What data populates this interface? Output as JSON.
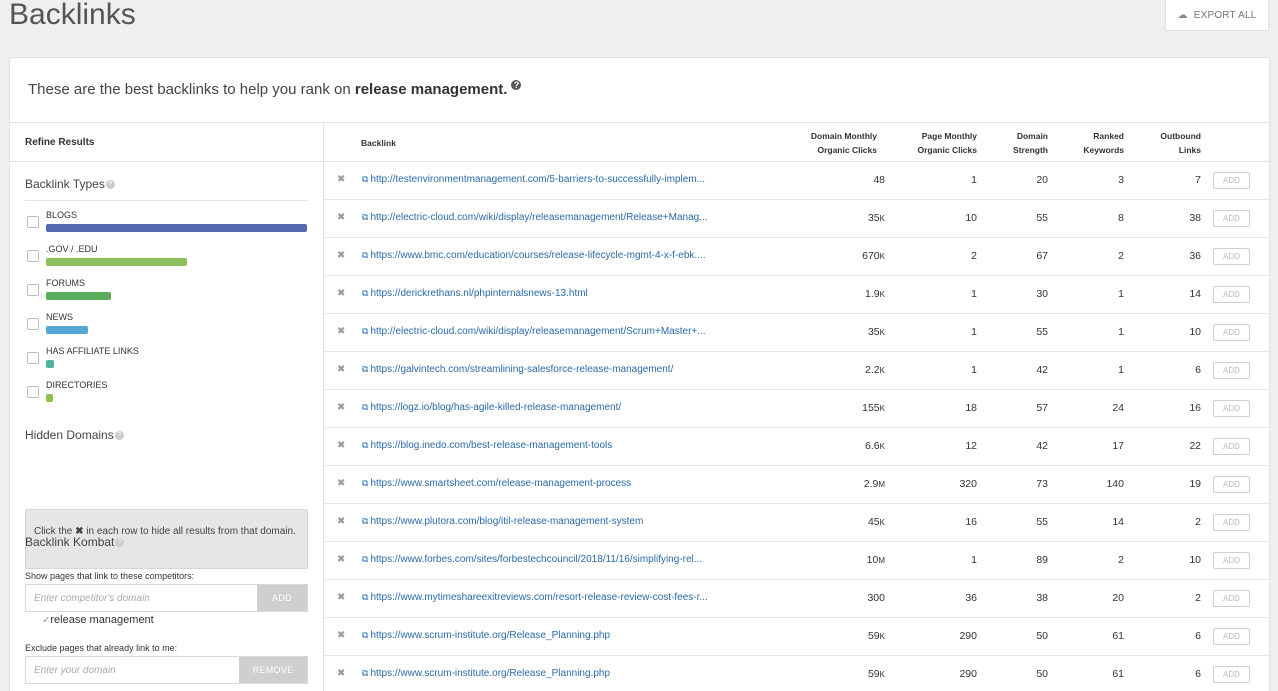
{
  "page": {
    "title": "Backlinks",
    "export_label": "EXPORT ALL"
  },
  "intro": {
    "prefix": "These are the best backlinks to help you rank on ",
    "keyword": "release management.",
    "help": "?"
  },
  "sidebar": {
    "refine_title": "Refine Results",
    "types_title": "Backlink Types",
    "types": [
      {
        "label": "BLOGS",
        "share": 1.0,
        "color": "#5468b0"
      },
      {
        "label": ".GOV / .EDU",
        "share": 0.54,
        "color": "#8dbd5c"
      },
      {
        "label": "FORUMS",
        "share": 0.25,
        "color": "#5aab5a"
      },
      {
        "label": "NEWS",
        "share": 0.16,
        "color": "#54a8d6"
      },
      {
        "label": "HAS AFFILIATE LINKS",
        "share": 0.03,
        "color": "#4fb49a"
      },
      {
        "label": "DIRECTORIES",
        "share": 0.02,
        "color": "#8fc04c"
      }
    ],
    "hidden_title": "Hidden Domains",
    "hidden_text_before": "Click the ",
    "hidden_text_icon": "✖",
    "hidden_text_after": " in each row to hide all results from that domain.",
    "kombat_title": "Backlink Kombat",
    "competitors_label": "Show pages that link to these competitors:",
    "competitor_placeholder": "Enter competitor's domain",
    "add_label": "ADD",
    "competitor_tag": "release management",
    "exclude_label": "Exclude pages that already link to me:",
    "domain_placeholder": "Enter your domain",
    "remove_label": "REMOVE"
  },
  "table": {
    "headers": {
      "backlink": "Backlink",
      "domain_clicks_1": "Domain Monthly",
      "domain_clicks_2": "Organic Clicks",
      "page_clicks_1": "Page Monthly",
      "page_clicks_2": "Organic Clicks",
      "strength_1": "Domain",
      "strength_2": "Strength",
      "ranked_1": "Ranked",
      "ranked_2": "Keywords",
      "outbound_1": "Outbound",
      "outbound_2": "Links"
    },
    "add_label": "ADD",
    "rows": [
      {
        "url": "http://testenvironmentmanagement.com/5-barriers-to-successfully-implem...",
        "domain_clicks": "48",
        "domain_unit": "",
        "page_clicks": "1",
        "strength": "20",
        "ranked": "3",
        "outbound": "7"
      },
      {
        "url": "http://electric-cloud.com/wiki/display/releasemanagement/Release+Manag...",
        "domain_clicks": "35",
        "domain_unit": "K",
        "page_clicks": "10",
        "strength": "55",
        "ranked": "8",
        "outbound": "38"
      },
      {
        "url": "https://www.bmc.com/education/courses/release-lifecycle-mgmt-4-x-f-ebk....",
        "domain_clicks": "670",
        "domain_unit": "K",
        "page_clicks": "2",
        "strength": "67",
        "ranked": "2",
        "outbound": "36"
      },
      {
        "url": "https://derickrethans.nl/phpinternalsnews-13.html",
        "domain_clicks": "1.9",
        "domain_unit": "K",
        "page_clicks": "1",
        "strength": "30",
        "ranked": "1",
        "outbound": "14"
      },
      {
        "url": "http://electric-cloud.com/wiki/display/releasemanagement/Scrum+Master+...",
        "domain_clicks": "35",
        "domain_unit": "K",
        "page_clicks": "1",
        "strength": "55",
        "ranked": "1",
        "outbound": "10"
      },
      {
        "url": "https://galvintech.com/streamlining-salesforce-release-management/",
        "domain_clicks": "2.2",
        "domain_unit": "K",
        "page_clicks": "1",
        "strength": "42",
        "ranked": "1",
        "outbound": "6"
      },
      {
        "url": "https://logz.io/blog/has-agile-killed-release-management/",
        "domain_clicks": "155",
        "domain_unit": "K",
        "page_clicks": "18",
        "strength": "57",
        "ranked": "24",
        "outbound": "16"
      },
      {
        "url": "https://blog.inedo.com/best-release-management-tools",
        "domain_clicks": "6.6",
        "domain_unit": "K",
        "page_clicks": "12",
        "strength": "42",
        "ranked": "17",
        "outbound": "22"
      },
      {
        "url": "https://www.smartsheet.com/release-management-process",
        "domain_clicks": "2.9",
        "domain_unit": "M",
        "page_clicks": "320",
        "strength": "73",
        "ranked": "140",
        "outbound": "19"
      },
      {
        "url": "https://www.plutora.com/blog/itil-release-management-system",
        "domain_clicks": "45",
        "domain_unit": "K",
        "page_clicks": "16",
        "strength": "55",
        "ranked": "14",
        "outbound": "2"
      },
      {
        "url": "https://www.forbes.com/sites/forbestechcouncil/2018/11/16/simplifying-rel...",
        "domain_clicks": "10",
        "domain_unit": "M",
        "page_clicks": "1",
        "strength": "89",
        "ranked": "2",
        "outbound": "10"
      },
      {
        "url": "https://www.mytimeshareexitreviews.com/resort-release-review-cost-fees-r...",
        "domain_clicks": "300",
        "domain_unit": "",
        "page_clicks": "36",
        "strength": "38",
        "ranked": "20",
        "outbound": "2"
      },
      {
        "url": "https://www.scrum-institute.org/Release_Planning.php",
        "domain_clicks": "59",
        "domain_unit": "K",
        "page_clicks": "290",
        "strength": "50",
        "ranked": "61",
        "outbound": "6"
      },
      {
        "url": "https://www.scrum-institute.org/Release_Planning.php",
        "domain_clicks": "59",
        "domain_unit": "K",
        "page_clicks": "290",
        "strength": "50",
        "ranked": "61",
        "outbound": "6"
      }
    ]
  }
}
